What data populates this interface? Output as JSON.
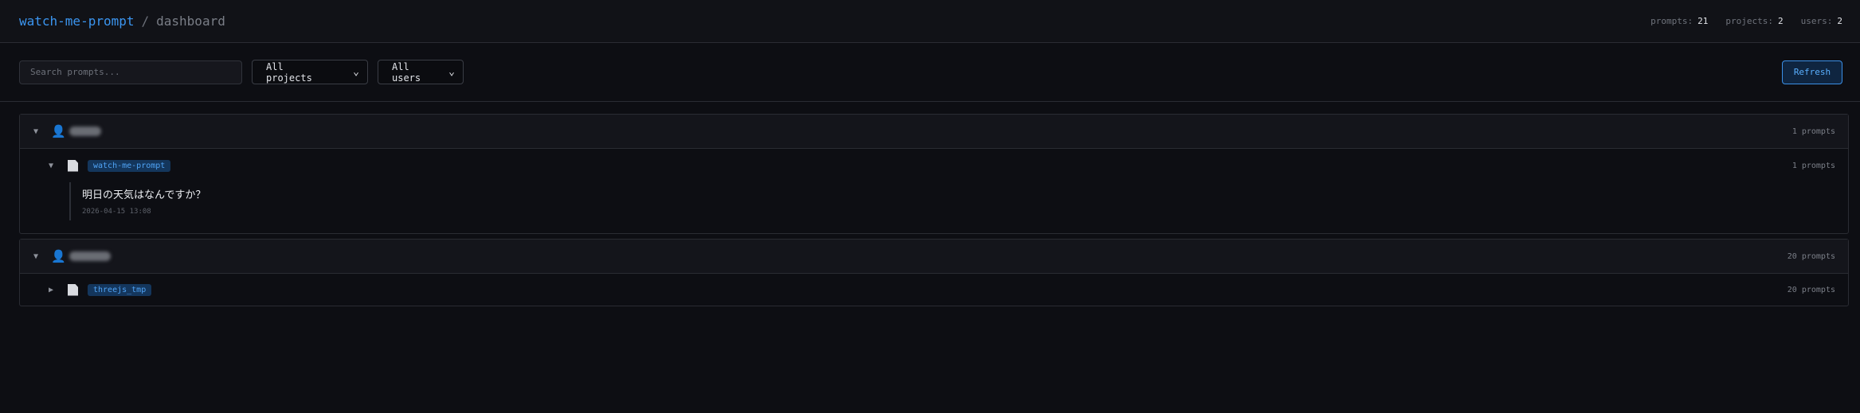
{
  "header": {
    "app_name": "watch-me-prompt",
    "separator": "/",
    "page": "dashboard",
    "stats": [
      {
        "label": "prompts:",
        "value": "21"
      },
      {
        "label": "projects:",
        "value": "2"
      },
      {
        "label": "users:",
        "value": "2"
      }
    ]
  },
  "toolbar": {
    "search_placeholder": "Search prompts...",
    "project_filter": "All projects",
    "user_filter": "All users",
    "refresh_label": "Refresh"
  },
  "icons": {
    "collapse": "triangle-down-icon",
    "expand": "triangle-right-icon",
    "user": "user-icon",
    "file": "file-icon"
  },
  "colors": {
    "accent": "#3b95f0",
    "tag_bg": "#14365c",
    "background": "#0d0e13"
  },
  "groups": [
    {
      "expanded": true,
      "count": "1 prompts",
      "projects": [
        {
          "name": "watch-me-prompt",
          "count": "1 prompts",
          "expanded": true,
          "prompts": [
            {
              "text": "明日の天気はなんですか？",
              "time": "2026-04-15 13:08"
            }
          ]
        }
      ]
    },
    {
      "expanded": true,
      "count": "20 prompts",
      "projects": [
        {
          "name": "threejs_tmp",
          "count": "20 prompts",
          "expanded": false
        }
      ]
    }
  ]
}
